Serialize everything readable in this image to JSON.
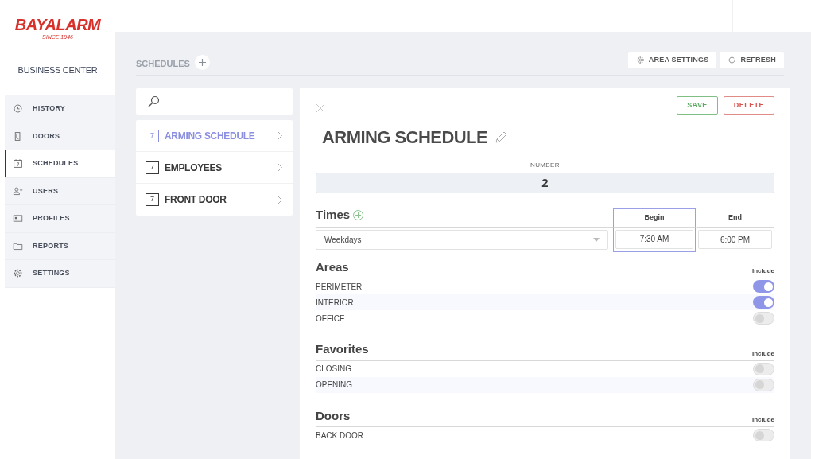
{
  "brand": {
    "name": "BAYALARM",
    "tagline": "SINCE 1946"
  },
  "sidebar": {
    "title": "BUSINESS CENTER",
    "items": [
      {
        "label": "HISTORY",
        "selected": false
      },
      {
        "label": "DOORS",
        "selected": false
      },
      {
        "label": "SCHEDULES",
        "selected": true
      },
      {
        "label": "USERS",
        "selected": false
      },
      {
        "label": "PROFILES",
        "selected": false
      },
      {
        "label": "REPORTS",
        "selected": false
      },
      {
        "label": "SETTINGS",
        "selected": false
      }
    ]
  },
  "header": {
    "title": "SCHEDULES",
    "buttons": [
      {
        "label": "AREA SETTINGS"
      },
      {
        "label": "REFRESH"
      }
    ]
  },
  "schedule_list": [
    {
      "label": "ARMING SCHEDULE",
      "day": "7",
      "selected": true
    },
    {
      "label": "EMPLOYEES",
      "day": "7",
      "selected": false
    },
    {
      "label": "FRONT DOOR",
      "day": "7",
      "selected": false
    }
  ],
  "detail": {
    "title": "ARMING SCHEDULE",
    "save": "SAVE",
    "delete": "DELETE",
    "number_label": "NUMBER",
    "number": "2",
    "times": {
      "title": "Times",
      "begin_label": "Begin",
      "end_label": "End",
      "begin_focused": true,
      "rows": [
        {
          "days": "Weekdays",
          "begin": "7:30 AM",
          "end": "6:00 PM"
        }
      ]
    },
    "sections": [
      {
        "title": "Areas",
        "column": "Include",
        "items": [
          {
            "label": "PERIMETER",
            "on": true
          },
          {
            "label": "INTERIOR",
            "on": true
          },
          {
            "label": "OFFICE",
            "on": false
          }
        ]
      },
      {
        "title": "Favorites",
        "column": "Include",
        "items": [
          {
            "label": "CLOSING",
            "on": false
          },
          {
            "label": "OPENING",
            "on": false
          }
        ]
      },
      {
        "title": "Doors",
        "column": "Include",
        "items": [
          {
            "label": "BACK DOOR",
            "on": false
          }
        ]
      }
    ]
  }
}
